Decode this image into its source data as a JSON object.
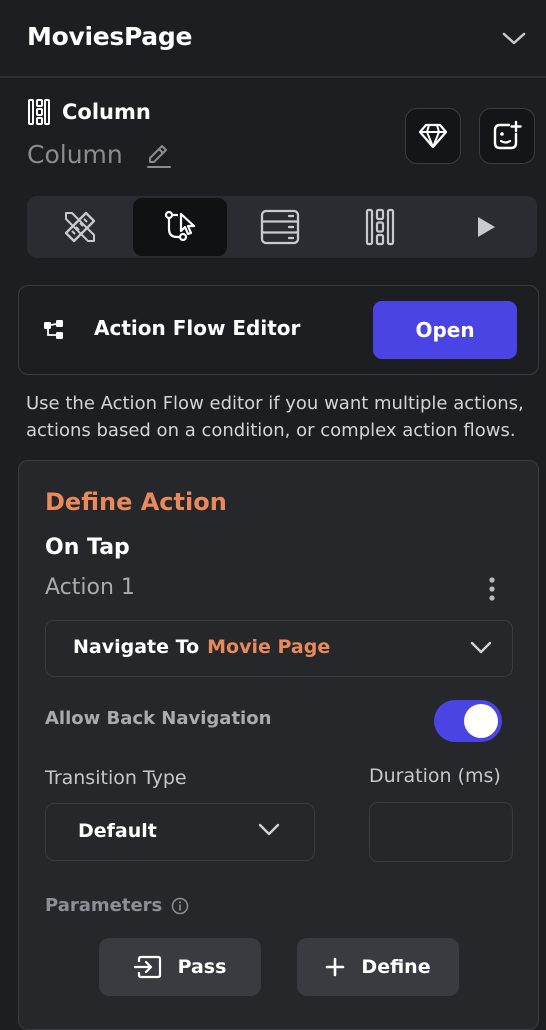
{
  "header": {
    "title": "MoviesPage",
    "collapse_icon": "chevron-down-icon"
  },
  "widget": {
    "type_label": "Column",
    "name": "Column",
    "type_icon": "column-icon",
    "edit_icon": "pencil-icon"
  },
  "top_actions": [
    {
      "icon": "diamond-icon"
    },
    {
      "icon": "add-widget-icon"
    }
  ],
  "tabs": [
    {
      "icon": "properties-ruler-icon",
      "active": false
    },
    {
      "icon": "actions-flow-icon",
      "active": true
    },
    {
      "icon": "backend-query-icon",
      "active": false
    },
    {
      "icon": "column-icon",
      "active": false
    },
    {
      "icon": "play-icon",
      "active": false
    }
  ],
  "action_flow_editor": {
    "icon": "flow-nodes-icon",
    "label": "Action Flow Editor",
    "open_label": "Open",
    "description": "Use the Action Flow editor if you want multiple actions, actions based on a condition, or complex action flows."
  },
  "define_action": {
    "title": "Define Action",
    "trigger": "On Tap",
    "action_name": "Action 1",
    "navigate": {
      "prefix": "Navigate To",
      "target": "Movie Page"
    },
    "allow_back_navigation": {
      "label": "Allow Back Navigation",
      "enabled": true
    },
    "transition_type": {
      "label": "Transition Type",
      "value": "Default"
    },
    "duration": {
      "label": "Duration (ms)",
      "value": ""
    },
    "parameters": {
      "label": "Parameters",
      "pass_label": "Pass",
      "define_label": "Define"
    }
  },
  "colors": {
    "accent": "#4a44e4",
    "highlight": "#e9895c",
    "background": "#1d1e22",
    "card": "#25272b"
  }
}
